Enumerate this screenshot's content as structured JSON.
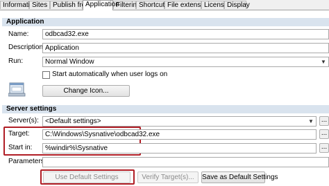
{
  "tabs": [
    {
      "label": "Information",
      "active": false
    },
    {
      "label": "Sites",
      "active": false
    },
    {
      "label": "Publish from",
      "active": false
    },
    {
      "label": "Application",
      "active": true
    },
    {
      "label": "Filtering",
      "active": false
    },
    {
      "label": "Shortcuts",
      "active": false
    },
    {
      "label": "File extensions",
      "active": false
    },
    {
      "label": "License",
      "active": false
    },
    {
      "label": "Display",
      "active": false
    }
  ],
  "application": {
    "header": "Application",
    "name_label": "Name:",
    "name_value": "odbcad32.exe",
    "description_label": "Description:",
    "description_value": "Application",
    "run_label": "Run:",
    "run_value": "Normal Window",
    "autostart_label": "Start automatically when user logs on",
    "autostart_checked": false,
    "change_icon_label": "Change Icon..."
  },
  "server": {
    "header": "Server settings",
    "servers_label": "Server(s):",
    "servers_value": "<Default settings>",
    "target_label": "Target:",
    "target_value": "C:\\Windows\\Sysnative\\odbcad32.exe",
    "startin_label": "Start in:",
    "startin_value": "%windir%\\Sysnative",
    "parameters_label": "Parameters:",
    "parameters_value": "",
    "browse_label": "...",
    "use_default_label": "Use Default Settings",
    "verify_label": "Verify Target(s)...",
    "save_default_label": "Save as Default Settings"
  },
  "colors": {
    "section_header_bg": "#d9e3ee",
    "highlight_red": "#b01c24"
  },
  "icons": {
    "app_icon": "application-window-icon"
  }
}
